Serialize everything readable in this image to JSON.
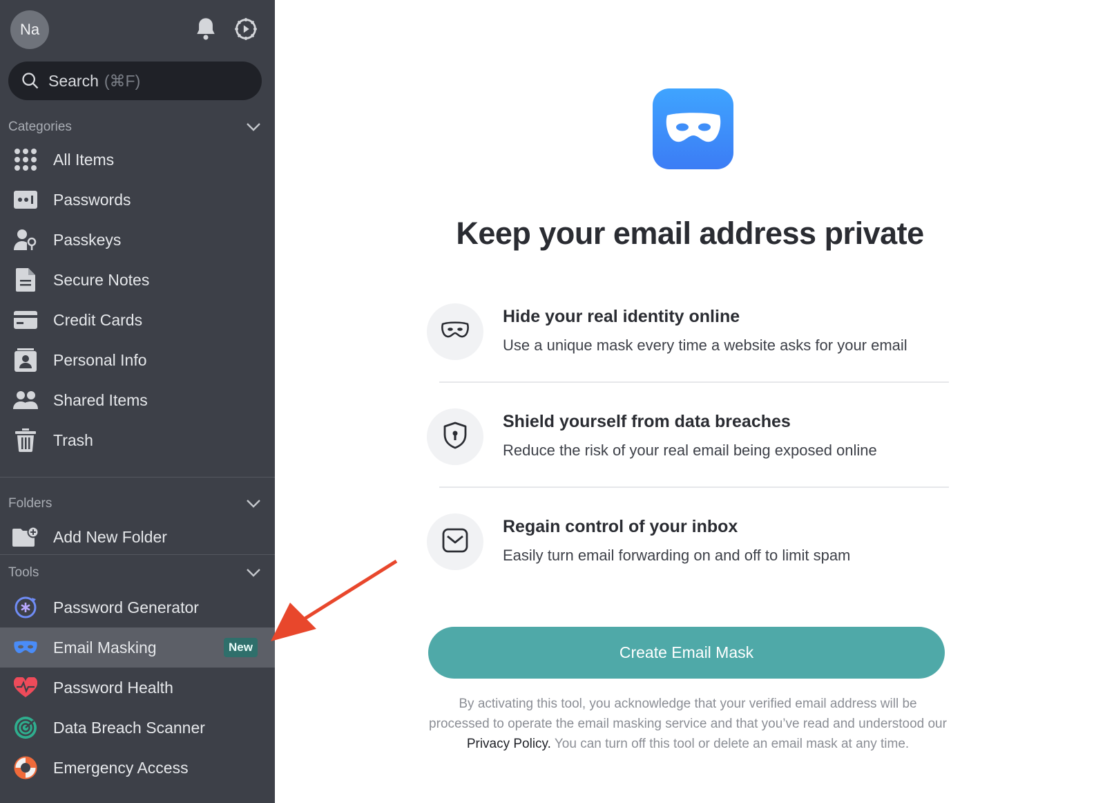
{
  "user": {
    "avatar_initials": "Na"
  },
  "header": {
    "icons": [
      "bell-icon",
      "settings-icon"
    ]
  },
  "search": {
    "placeholder": "Search",
    "shortcut": "(⌘F)"
  },
  "categories": {
    "label": "Categories",
    "items": [
      {
        "label": "All Items",
        "icon": "grid-icon"
      },
      {
        "label": "Passwords",
        "icon": "password-icon"
      },
      {
        "label": "Passkeys",
        "icon": "passkey-icon"
      },
      {
        "label": "Secure Notes",
        "icon": "note-icon"
      },
      {
        "label": "Credit Cards",
        "icon": "credit-card-icon"
      },
      {
        "label": "Personal Info",
        "icon": "id-badge-icon"
      },
      {
        "label": "Shared Items",
        "icon": "people-icon"
      },
      {
        "label": "Trash",
        "icon": "trash-icon"
      }
    ]
  },
  "folders": {
    "label": "Folders",
    "items": [
      {
        "label": "Add New Folder",
        "icon": "folder-add-icon"
      }
    ]
  },
  "tools": {
    "label": "Tools",
    "items": [
      {
        "label": "Password Generator",
        "icon": "generator-icon"
      },
      {
        "label": "Email Masking",
        "icon": "mask-icon",
        "badge": "New",
        "active": true
      },
      {
        "label": "Password Health",
        "icon": "heart-pulse-icon"
      },
      {
        "label": "Data Breach Scanner",
        "icon": "radar-icon"
      },
      {
        "label": "Emergency Access",
        "icon": "lifebuoy-icon"
      }
    ]
  },
  "main": {
    "headline": "Keep your email address private",
    "features": [
      {
        "title": "Hide your real identity online",
        "description": "Use a unique mask every time a website asks for your email",
        "icon": "mask-icon"
      },
      {
        "title": "Shield yourself from data breaches",
        "description": "Reduce the risk of your real email being exposed online",
        "icon": "shield-lock-icon"
      },
      {
        "title": "Regain control of your inbox",
        "description": "Easily turn email forwarding on and off to limit spam",
        "icon": "mail-icon"
      }
    ],
    "cta_label": "Create Email Mask",
    "legal": {
      "before": "By activating this tool, you acknowledge that your verified email address will be processed to operate the email masking service and that you’ve read and understood our ",
      "link": "Privacy Policy.",
      "after": " You can turn off this tool or delete an email mask at any time."
    }
  },
  "colors": {
    "sidebar_bg": "#3d4048",
    "accent_teal": "#4fa9a8",
    "hero_blue": "#3c8dfa",
    "annotation_arrow": "#e8472c"
  }
}
